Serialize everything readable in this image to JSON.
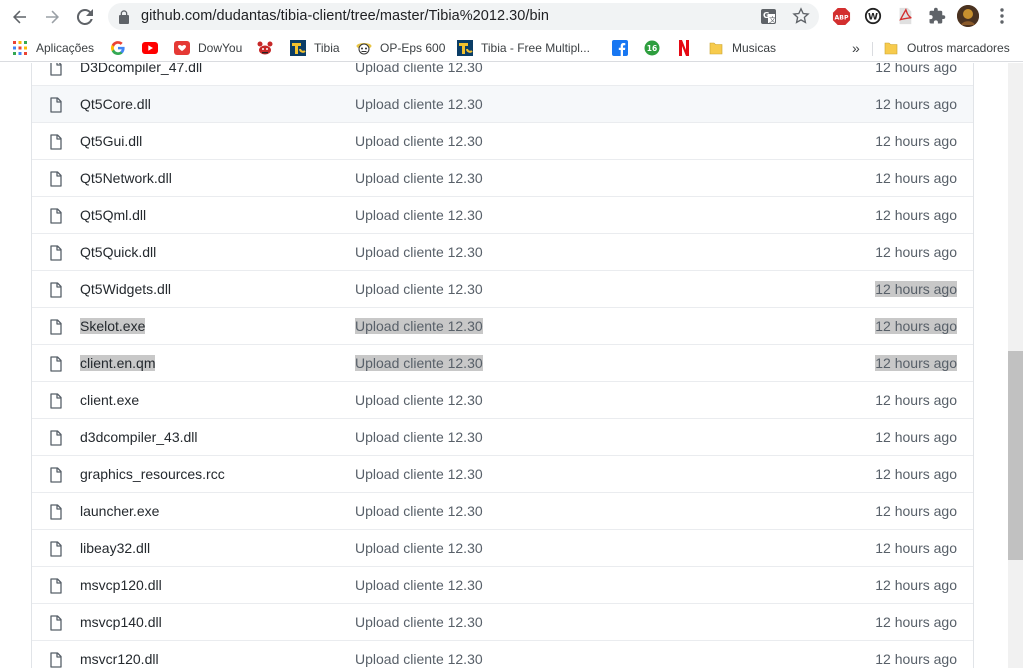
{
  "browser": {
    "url": "github.com/dudantas/tibia-client/tree/master/Tibia%2012.30/bin",
    "bookmarks": [
      {
        "label": "Aplicações",
        "icon": "apps-grid-icon"
      },
      {
        "label": "",
        "icon": "google-icon"
      },
      {
        "label": "",
        "icon": "youtube-icon"
      },
      {
        "label": "DowYou",
        "icon": "dowyou-icon"
      },
      {
        "label": "",
        "icon": "crab-icon"
      },
      {
        "label": "Tibia",
        "icon": "tibia-icon"
      },
      {
        "label": "OP-Eps 600",
        "icon": "onepiece-icon"
      },
      {
        "label": "Tibia - Free Multipl...",
        "icon": "tibia-icon"
      },
      {
        "label": "",
        "icon": "facebook-icon"
      },
      {
        "label": "",
        "icon": "badge-16-icon"
      },
      {
        "label": "",
        "icon": "netflix-icon"
      },
      {
        "label": "Musicas",
        "icon": "folder-icon"
      }
    ],
    "overflow_label": "»",
    "other_bookmarks": "Outros marcadores",
    "extensions": {
      "abp": "ABP",
      "badge_16": "16"
    }
  },
  "files": [
    {
      "name": "D3Dcompiler_47.dll",
      "message": "Upload cliente 12.30",
      "age": "12 hours ago"
    },
    {
      "name": "Qt5Core.dll",
      "message": "Upload cliente 12.30",
      "age": "12 hours ago"
    },
    {
      "name": "Qt5Gui.dll",
      "message": "Upload cliente 12.30",
      "age": "12 hours ago"
    },
    {
      "name": "Qt5Network.dll",
      "message": "Upload cliente 12.30",
      "age": "12 hours ago"
    },
    {
      "name": "Qt5Qml.dll",
      "message": "Upload cliente 12.30",
      "age": "12 hours ago"
    },
    {
      "name": "Qt5Quick.dll",
      "message": "Upload cliente 12.30",
      "age": "12 hours ago"
    },
    {
      "name": "Qt5Widgets.dll",
      "message": "Upload cliente 12.30",
      "age": "12 hours ago"
    },
    {
      "name": "Skelot.exe",
      "message": "Upload cliente 12.30",
      "age": "12 hours ago"
    },
    {
      "name": "client.en.qm",
      "message": "Upload cliente 12.30",
      "age": "12 hours ago"
    },
    {
      "name": "client.exe",
      "message": "Upload cliente 12.30",
      "age": "12 hours ago"
    },
    {
      "name": "d3dcompiler_43.dll",
      "message": "Upload cliente 12.30",
      "age": "12 hours ago"
    },
    {
      "name": "graphics_resources.rcc",
      "message": "Upload cliente 12.30",
      "age": "12 hours ago"
    },
    {
      "name": "launcher.exe",
      "message": "Upload cliente 12.30",
      "age": "12 hours ago"
    },
    {
      "name": "libeay32.dll",
      "message": "Upload cliente 12.30",
      "age": "12 hours ago"
    },
    {
      "name": "msvcp120.dll",
      "message": "Upload cliente 12.30",
      "age": "12 hours ago"
    },
    {
      "name": "msvcp140.dll",
      "message": "Upload cliente 12.30",
      "age": "12 hours ago"
    },
    {
      "name": "msvcr120.dll",
      "message": "Upload cliente 12.30",
      "age": "12 hours ago"
    }
  ]
}
